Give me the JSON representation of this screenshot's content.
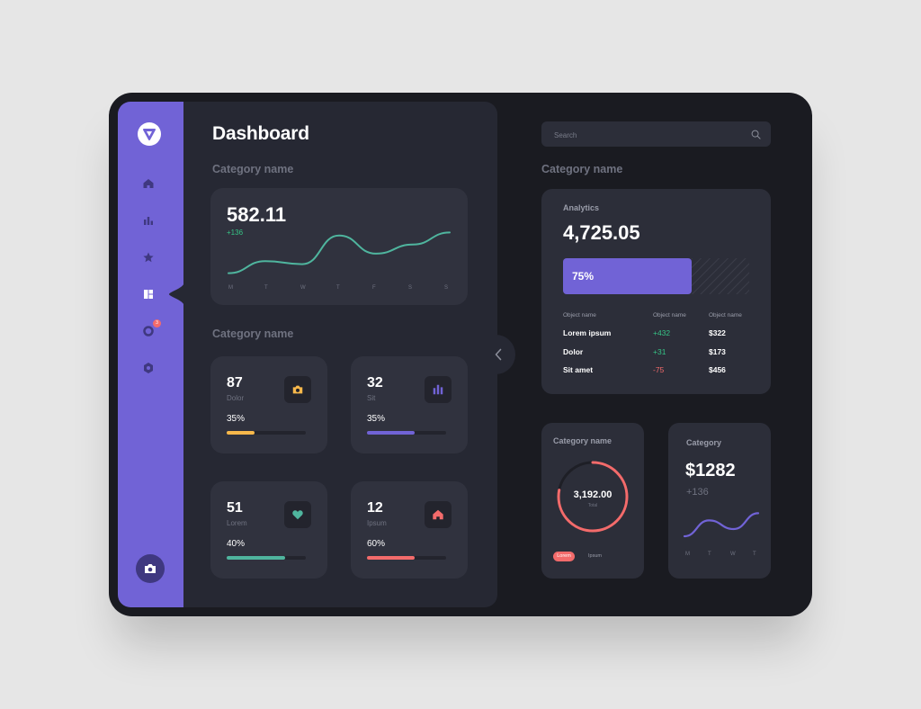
{
  "sidebar": {
    "items": [
      {
        "icon": "home-icon"
      },
      {
        "icon": "bar-chart-icon"
      },
      {
        "icon": "star-icon"
      },
      {
        "icon": "dashboard-icon",
        "active": true
      },
      {
        "icon": "notification-icon",
        "badge": "3"
      },
      {
        "icon": "settings-icon"
      }
    ],
    "bottom_icon": "camera-icon",
    "accent": "#7163d6"
  },
  "main": {
    "title": "Dashboard",
    "section1_title": "Category name",
    "line_card": {
      "value": "582.11",
      "delta": "+136",
      "days": [
        "M",
        "T",
        "W",
        "T",
        "F",
        "S",
        "S"
      ]
    },
    "section2_title": "Category name",
    "stats": [
      {
        "value": "87",
        "label": "Dolor",
        "percent": "35%",
        "fill": 0.35,
        "color": "#f7b84b",
        "icon": "camera-icon"
      },
      {
        "value": "32",
        "label": "Sit",
        "percent": "35%",
        "fill": 0.6,
        "color": "#7163d6",
        "icon": "bar-chart-icon"
      },
      {
        "value": "51",
        "label": "Lorem",
        "percent": "40%",
        "fill": 0.74,
        "color": "#4fb59e",
        "icon": "heart-icon"
      },
      {
        "value": "12",
        "label": "Ipsum",
        "percent": "60%",
        "fill": 0.6,
        "color": "#f36b6b",
        "icon": "home-icon"
      }
    ]
  },
  "right": {
    "search_placeholder": "Search",
    "section_title": "Category name",
    "analytics": {
      "label": "Analytics",
      "value": "4,725.05",
      "bar_label": "75%",
      "bar_fill": 0.69,
      "headers": [
        "Object name",
        "Object name",
        "Object name"
      ],
      "rows": [
        {
          "name": "Lorem ipsum",
          "delta": "+432",
          "amount": "$322",
          "trend": "up"
        },
        {
          "name": "Dolor",
          "delta": "+31",
          "amount": "$173",
          "trend": "up"
        },
        {
          "name": "Sit amet",
          "delta": "-75",
          "amount": "$456",
          "trend": "down"
        }
      ]
    },
    "donut_card": {
      "title": "Category name",
      "value": "3,192.00",
      "sub": "Total",
      "fill": 0.78,
      "legend": [
        "Lorem",
        "Ipsum"
      ]
    },
    "money_card": {
      "title": "Category",
      "value": "$1282",
      "delta": "+136",
      "days": [
        "M",
        "T",
        "W",
        "T"
      ]
    }
  },
  "chart_data": [
    {
      "type": "line",
      "categories": [
        "M",
        "T",
        "W",
        "T",
        "F",
        "S",
        "S"
      ],
      "series": [
        {
          "values": [
            10,
            26,
            22,
            60,
            36,
            48,
            64
          ]
        }
      ],
      "ylim": [
        0,
        80
      ],
      "grid": false,
      "color": "#4fb59e"
    },
    {
      "type": "line",
      "categories": [
        "M",
        "T",
        "W",
        "T"
      ],
      "series": [
        {
          "values": [
            10,
            32,
            20,
            42
          ]
        }
      ],
      "ylim": [
        0,
        50
      ],
      "grid": false,
      "color": "#7163d6"
    }
  ]
}
